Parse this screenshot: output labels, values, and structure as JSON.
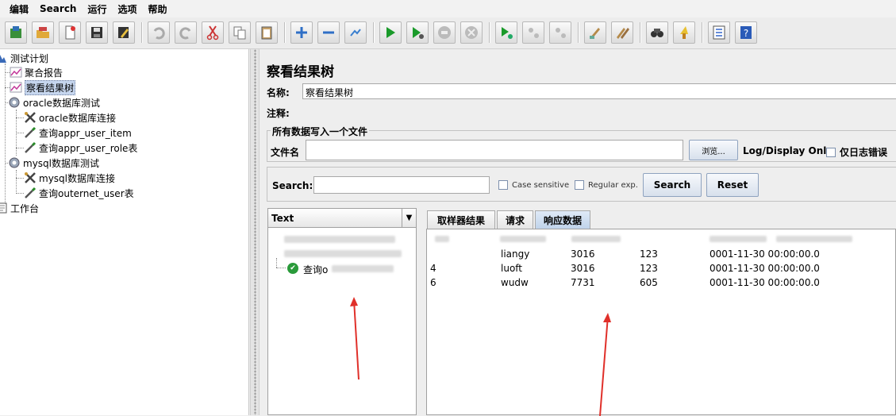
{
  "menu": [
    "编辑",
    "Search",
    "运行",
    "选项",
    "帮助"
  ],
  "toolbar_icons": [
    "template-icon",
    "open-icon",
    "new-icon",
    "save-icon",
    "edit-icon",
    "undo-icon",
    "redo-icon",
    "cut-icon",
    "copy-icon",
    "paste-icon",
    "expand-icon",
    "collapse-icon",
    "toggle-icon",
    "start-icon",
    "start-no-pause-icon",
    "stop-icon",
    "shutdown-icon",
    "remote-start-icon",
    "remote-stop-icon",
    "remote-shutdown-icon",
    "clear-icon",
    "clear-all-icon",
    "search-icon",
    "reset-search-icon",
    "function-helper-icon",
    "help-icon"
  ],
  "tree": {
    "items": [
      {
        "label": "测试计划",
        "icon": "test-plan-icon"
      },
      {
        "label": "聚合报告",
        "icon": "chart-icon"
      },
      {
        "label": "察看结果树",
        "icon": "chart-icon"
      },
      {
        "label": "oracle数据库测试",
        "icon": "gear-icon"
      },
      {
        "label": "oracle数据库连接",
        "icon": "wrench-icon"
      },
      {
        "label": "查询appr_user_item",
        "icon": "pipette-icon"
      },
      {
        "label": "查询appr_user_role表",
        "icon": "pipette-icon"
      },
      {
        "label": "mysql数据库测试",
        "icon": "gear-icon"
      },
      {
        "label": "mysql数据库连接",
        "icon": "wrench-icon"
      },
      {
        "label": "查询outernet_user表",
        "icon": "pipette-icon"
      },
      {
        "label": "工作台",
        "icon": "workbench-icon"
      }
    ]
  },
  "panel": {
    "title": "察看结果树",
    "name_label": "名称:",
    "name_value": "察看结果树",
    "comment_label": "注释:",
    "file_group_title": "所有数据写入一个文件",
    "file_label": "文件名",
    "browse_label": "浏览...",
    "log_display_label": "Log/Display Only:",
    "errors_only_label": "仅日志错误"
  },
  "search": {
    "label": "Search:",
    "case_sensitive": "Case sensitive",
    "regular_exp": "Regular exp.",
    "search_button": "Search",
    "reset_button": "Reset"
  },
  "renderer": {
    "selected": "Text",
    "visible_sample": "查询o"
  },
  "tabs": [
    "取样器结果",
    "请求",
    "响应数据"
  ],
  "rows": [
    {
      "id": "",
      "name": "liangy",
      "a": "3016",
      "b": "123",
      "date": "0001-11-30 00:00:00.0"
    },
    {
      "id": "4",
      "name": "luoft",
      "a": "3016",
      "b": "123",
      "date": "0001-11-30 00:00:00.0"
    },
    {
      "id": "6",
      "name": "wudw",
      "a": "7731",
      "b": "605",
      "date": "0001-11-30 00:00:00.0"
    }
  ],
  "colors": {
    "arrow": "#e0302a",
    "selection": "#c6d6ee",
    "active_tab": "#bfd2ea"
  }
}
